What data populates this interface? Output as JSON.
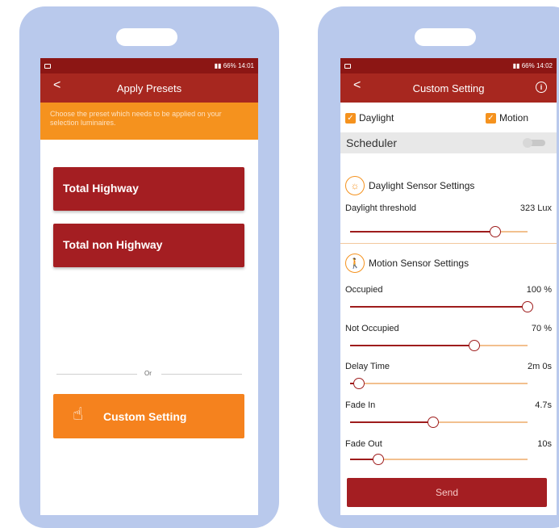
{
  "left_phone": {
    "status": {
      "time": "14:01",
      "battery": "66%"
    },
    "appbar": {
      "back": "<",
      "title": "Apply Presets"
    },
    "notice": "Choose the preset which needs to be applied on your selection luminaires.",
    "presets": [
      {
        "label": "Total Highway"
      },
      {
        "label": "Total non Highway"
      }
    ],
    "or_text": "Or",
    "custom_button": {
      "label": "Custom Setting",
      "icon": "hand-tap-icon"
    }
  },
  "right_phone": {
    "status": {
      "time": "14:02",
      "battery": "66%"
    },
    "appbar": {
      "back": "<",
      "title": "Custom Setting",
      "info": "i"
    },
    "checks": {
      "daylight": "Daylight",
      "motion": "Motion",
      "check_mark": "✓"
    },
    "scheduler": {
      "label": "Scheduler",
      "enabled": false
    },
    "daylight_section": {
      "title": "Daylight Sensor Settings",
      "icon": "sun-icon"
    },
    "daylight_threshold": {
      "label": "Daylight threshold",
      "value": "323 Lux",
      "level": 0.82
    },
    "motion_section": {
      "title": "Motion Sensor Settings",
      "icon": "walking-person-icon"
    },
    "sliders": [
      {
        "key": "occupied",
        "label": "Occupied",
        "value": "100 %",
        "level": 1.0
      },
      {
        "key": "not_occupied",
        "label": "Not Occupied",
        "value": "70 %",
        "level": 0.7
      },
      {
        "key": "delay_time",
        "label": "Delay Time",
        "value": "2m 0s",
        "level": 0.05
      },
      {
        "key": "fade_in",
        "label": "Fade In",
        "value": "4.7s",
        "level": 0.47
      },
      {
        "key": "fade_out",
        "label": "Fade Out",
        "value": "10s",
        "level": 0.16
      }
    ],
    "send_label": "Send"
  },
  "colors": {
    "phone_frame": "#b9c9ec",
    "status_bar": "#8c1614",
    "app_bar": "#a7271f",
    "preset_button": "#a41e22",
    "accent_orange": "#f5821e"
  }
}
